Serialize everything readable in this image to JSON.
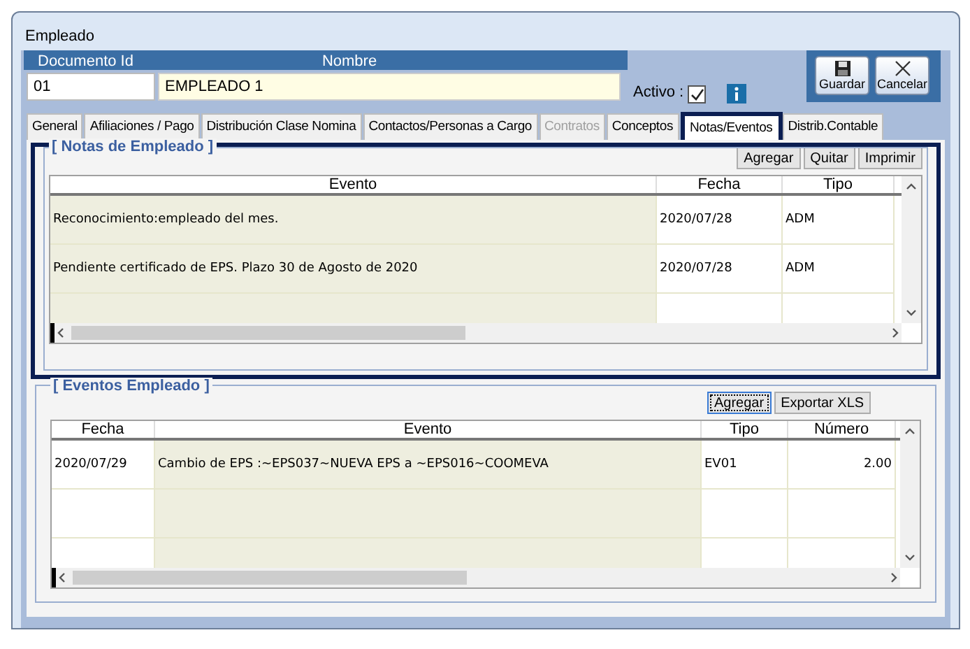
{
  "window": {
    "title": "Empleado"
  },
  "header": {
    "columns": [
      "Documento Id",
      "Nombre"
    ],
    "documento_id": "01",
    "nombre": "EMPLEADO 1",
    "activo_label": "Activo :",
    "activo_checked": true
  },
  "actions": [
    {
      "kind": "save",
      "label": "Guardar"
    },
    {
      "kind": "cancel",
      "label": "Cancelar"
    }
  ],
  "tabs": [
    {
      "label": "General",
      "selected": false,
      "disabled": false
    },
    {
      "label": "Afiliaciones / Pago",
      "selected": false,
      "disabled": false
    },
    {
      "label": "Distribución Clase Nomina",
      "selected": false,
      "disabled": false
    },
    {
      "label": "Contactos/Personas a Cargo",
      "selected": false,
      "disabled": false
    },
    {
      "label": "Contratos",
      "selected": false,
      "disabled": true
    },
    {
      "label": "Conceptos",
      "selected": false,
      "disabled": false
    },
    {
      "label": "Notas/Eventos",
      "selected": true,
      "disabled": false
    },
    {
      "label": "Distrib.Contable",
      "selected": false,
      "disabled": false
    }
  ],
  "notas": {
    "title": "[ Notas de Empleado ]",
    "buttons": [
      {
        "label": "Agregar",
        "focused": false
      },
      {
        "label": "Quitar",
        "focused": false
      },
      {
        "label": "Imprimir",
        "focused": false
      }
    ],
    "columns": [
      "Evento",
      "Fecha",
      "Tipo"
    ],
    "rows": [
      [
        "Reconocimiento:empleado del mes.",
        "2020/07/28",
        "ADM"
      ],
      [
        "Pendiente certificado de EPS. Plazo 30 de Agosto de 2020",
        "2020/07/28",
        "ADM"
      ]
    ]
  },
  "eventos": {
    "title": "[ Eventos Empleado ]",
    "buttons": [
      {
        "label": "Agregar",
        "focused": true
      },
      {
        "label": "Exportar XLS",
        "focused": false
      }
    ],
    "columns": [
      "Fecha",
      "Evento",
      "Tipo",
      "Número"
    ],
    "rows": [
      [
        "2020/07/29",
        "Cambio de EPS :~EPS037~NUEVA EPS a ~EPS016~COOMEVA",
        "EV01",
        "2.00"
      ]
    ]
  }
}
